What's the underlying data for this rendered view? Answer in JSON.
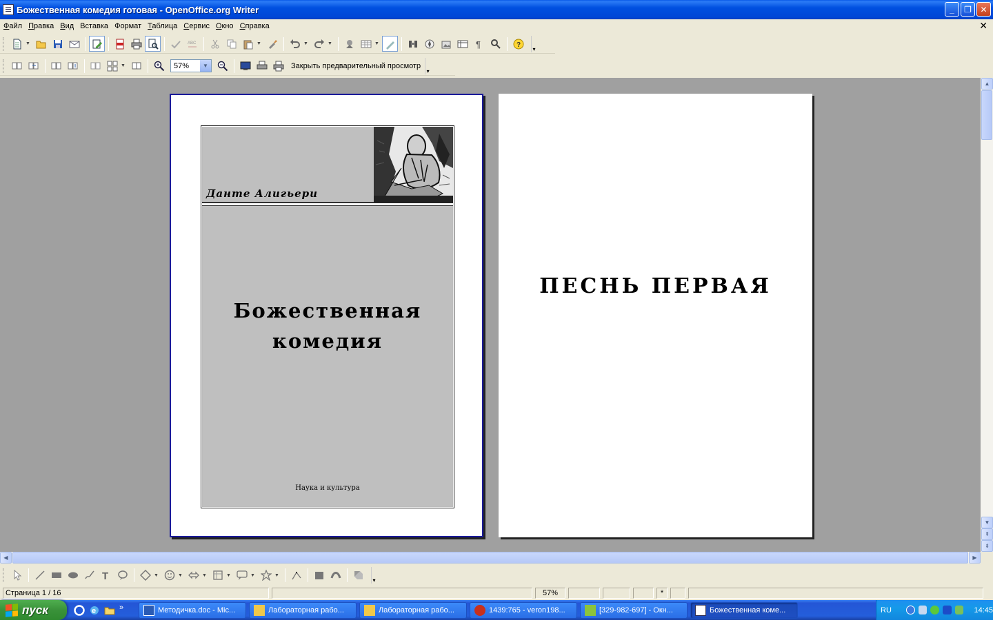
{
  "window": {
    "title": "Божественная комедия готовая - OpenOffice.org Writer",
    "minimize": "_",
    "restore": "❐",
    "close": "✕"
  },
  "menu": [
    {
      "first": "Ф",
      "rest": "айл"
    },
    {
      "first": "П",
      "rest": "равка"
    },
    {
      "first": "В",
      "rest": "ид"
    },
    {
      "first": "В",
      "rest": "ставка"
    },
    {
      "first": "Ф",
      "rest": "ормат"
    },
    {
      "first": "Т",
      "rest": "аблица"
    },
    {
      "first": "С",
      "rest": "ервис"
    },
    {
      "first": "О",
      "rest": "кно"
    },
    {
      "first": "С",
      "rest": "правка"
    }
  ],
  "doc_close": "✕",
  "preview_toolbar": {
    "zoom_value": "57%",
    "close_preview_label": "Закрыть предварительный просмотр"
  },
  "page1": {
    "author": "Данте Алигьери",
    "title_line1": "Божественная",
    "title_line2": "комедия",
    "publisher": "Наука и культура"
  },
  "page2": {
    "heading": "ПЕСНЬ ПЕРВАЯ"
  },
  "status": {
    "page": "Страница  1 / 16",
    "zoom": "57%",
    "modified": "*"
  },
  "taskbar": {
    "start_label": "пуск",
    "more": "»",
    "tasks": [
      {
        "label": "Методичка.doc - Mic...",
        "icon_color": "#2a5bb5"
      },
      {
        "label": "Лабораторная рабо...",
        "icon_color": "#f0c84a"
      },
      {
        "label": "Лабораторная рабо...",
        "icon_color": "#f0c84a"
      },
      {
        "label": "1439:765 - veron198...",
        "icon_color": "#c8301c"
      },
      {
        "label": "[329-982-697] - Окн...",
        "icon_color": "#8cc43c"
      },
      {
        "label": "Божественная коме...",
        "icon_color": "#ffffff"
      }
    ],
    "lang": "RU",
    "clock": "14:45"
  },
  "colors": {
    "titlebar": "#0050e0",
    "workspace": "#a0a0a0",
    "cover_fill": "#bfbfbf",
    "page1_border": "#1a1a9a",
    "taskbar": "#245edb",
    "start": "#3a923a"
  }
}
